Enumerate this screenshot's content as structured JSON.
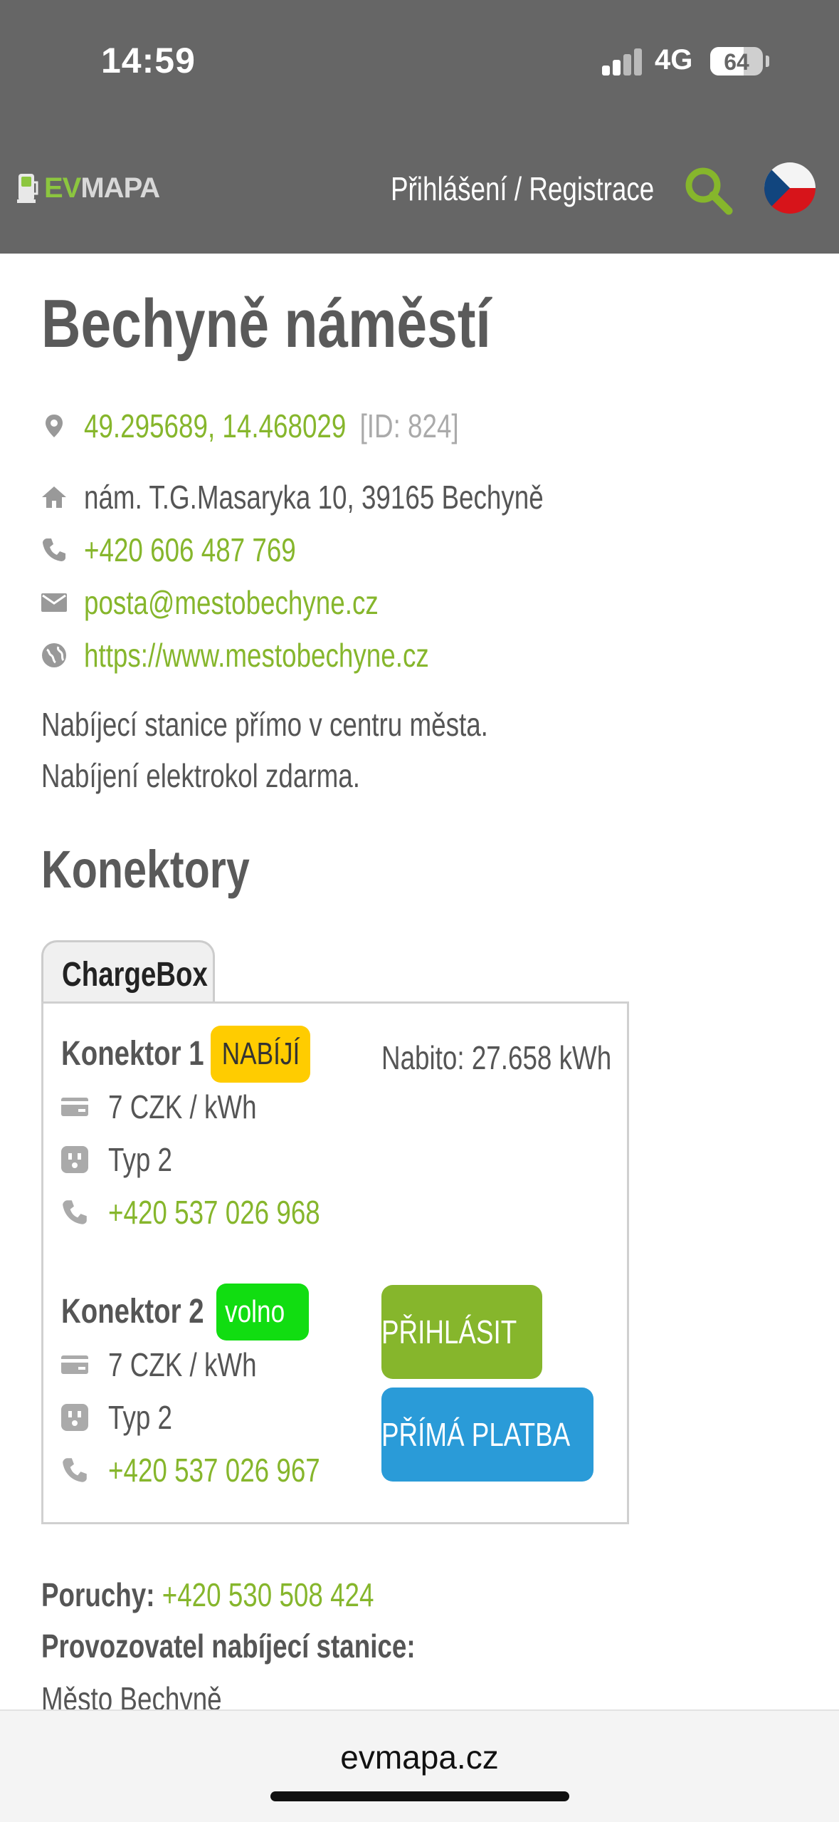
{
  "status_bar": {
    "time": "14:59",
    "network": "4G",
    "battery": "64",
    "battery_fraction": 0.64
  },
  "header": {
    "logo_ev": "EV",
    "logo_mapa": "MAPA",
    "login_link": "Přihlášení / Registrace",
    "search_icon": "search-icon",
    "language_icon": "czech-flag-icon"
  },
  "station": {
    "title": "Bechyně náměstí",
    "coords": "49.295689, 14.468029",
    "id_label": "[ID: 824]",
    "address": "nám. T.G.Masaryka 10, 39165 Bechyně",
    "phone": "+420 606 487 769",
    "email": "posta@mestobechyne.cz",
    "website": "https://www.mestobechyne.cz",
    "description": [
      "Nabíjecí stanice přímo v centru města.",
      "Nabíjení elektrokol zdarma."
    ]
  },
  "connectors_heading": "Konektory",
  "tab_label": "ChargeBox",
  "connectors": [
    {
      "name": "Konektor 1",
      "status": "NABÍJÍ",
      "status_color": "#ffcc00",
      "price": "7 CZK / kWh",
      "type": "Typ 2",
      "phone": "+420 537 026 968",
      "charged": "Nabito: 27.658 kWh"
    },
    {
      "name": "Konektor 2",
      "status": "volno",
      "status_color": "#11dd11",
      "price": "7 CZK / kWh",
      "type": "Typ 2",
      "phone": "+420 537 026 967"
    }
  ],
  "buttons": {
    "login": "PŘIHLÁSIT",
    "direct_payment": "PŘÍMÁ PLATBA"
  },
  "faults": {
    "label": "Poruchy:",
    "phone": "+420 530 508 424"
  },
  "operator": {
    "label": "Provozovatel nabíjecí stanice:",
    "name": "Město Bechyně"
  },
  "browser": {
    "url": "evmapa.cz"
  },
  "colors": {
    "accent_green": "#86b62c",
    "header_gray": "#666666",
    "pay_blue": "#2a9bd8"
  }
}
